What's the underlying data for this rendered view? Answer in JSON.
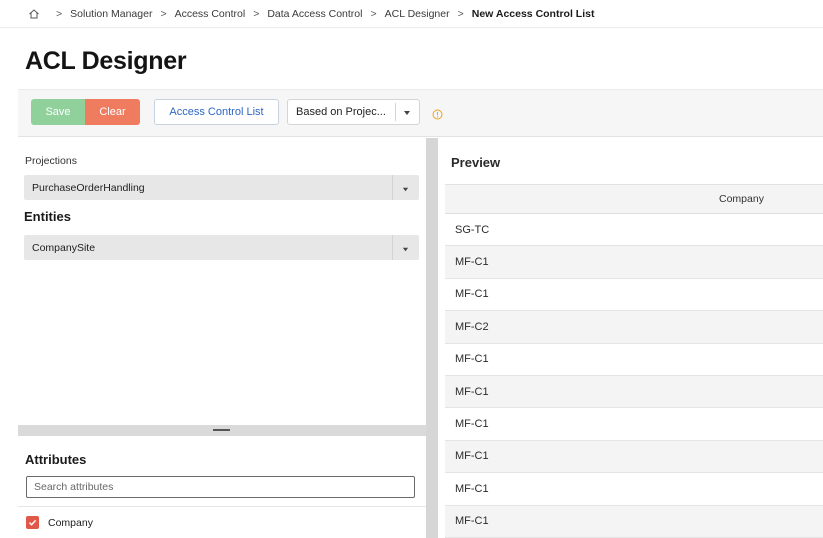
{
  "breadcrumb": {
    "items": [
      "Solution Manager",
      "Access Control",
      "Data Access Control",
      "ACL Designer"
    ],
    "current": "New Access Control List",
    "separator": ">"
  },
  "page": {
    "title": "ACL Designer"
  },
  "toolbar": {
    "save_label": "Save",
    "clear_label": "Clear",
    "acl_label": "Access Control List",
    "based_on_value": "Based on Projec..."
  },
  "left": {
    "projections_label": "Projections",
    "projection_value": "PurchaseOrderHandling",
    "entities_label": "Entities",
    "entity_value": "CompanySite"
  },
  "attributes": {
    "title": "Attributes",
    "search_placeholder": "Search attributes",
    "items": [
      {
        "label": "Company",
        "checked": true
      }
    ]
  },
  "preview": {
    "title": "Preview",
    "column": "Company",
    "rows": [
      "SG-TC",
      "MF-C1",
      "MF-C1",
      "MF-C2",
      "MF-C1",
      "MF-C1",
      "MF-C1",
      "MF-C1",
      "MF-C1",
      "MF-C1"
    ]
  },
  "colors": {
    "save": "#8fd09b",
    "clear": "#ef7c5f",
    "link": "#2e67c3",
    "checkbox": "#e0584a",
    "warning": "#f0a020"
  }
}
